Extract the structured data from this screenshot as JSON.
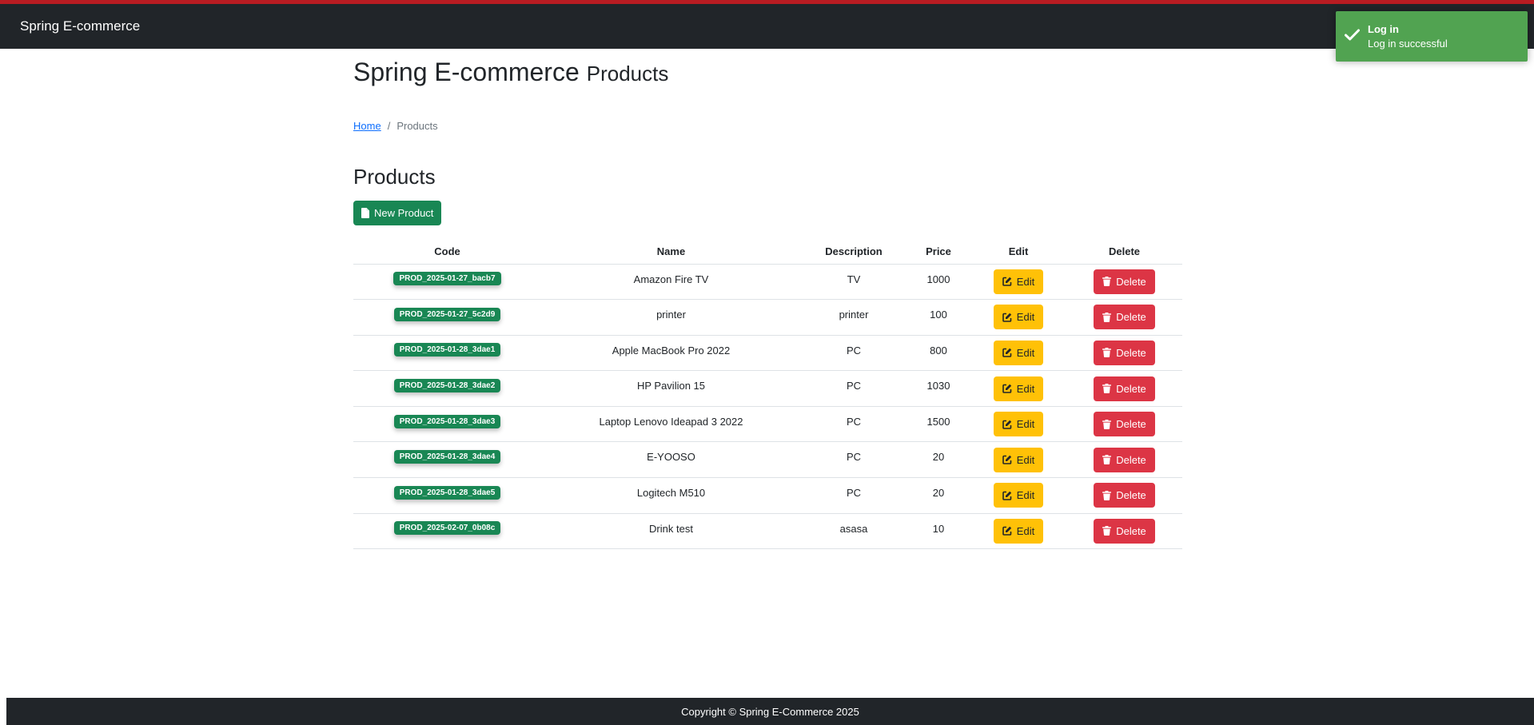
{
  "navbar": {
    "brand": "Spring E-commerce"
  },
  "header": {
    "title": "Spring E-commerce",
    "subtitle": "Products"
  },
  "breadcrumb": {
    "home": "Home",
    "current": "Products"
  },
  "section": {
    "title": "Products",
    "new_button": "New Product"
  },
  "table": {
    "headers": [
      "Code",
      "Name",
      "Description",
      "Price",
      "Edit",
      "Delete"
    ],
    "edit_label": "Edit",
    "delete_label": "Delete",
    "rows": [
      {
        "code": "PROD_2025-01-27_bacb7",
        "name": "Amazon Fire TV",
        "description": "TV",
        "price": "1000"
      },
      {
        "code": "PROD_2025-01-27_5c2d9",
        "name": "printer",
        "description": "printer",
        "price": "100"
      },
      {
        "code": "PROD_2025-01-28_3dae1",
        "name": "Apple MacBook Pro 2022",
        "description": "PC",
        "price": "800"
      },
      {
        "code": "PROD_2025-01-28_3dae2",
        "name": "HP Pavilion 15",
        "description": "PC",
        "price": "1030"
      },
      {
        "code": "PROD_2025-01-28_3dae3",
        "name": "Laptop Lenovo Ideapad 3 2022",
        "description": "PC",
        "price": "1500"
      },
      {
        "code": "PROD_2025-01-28_3dae4",
        "name": "E-YOOSO",
        "description": "PC",
        "price": "20"
      },
      {
        "code": "PROD_2025-01-28_3dae5",
        "name": "Logitech M510",
        "description": "PC",
        "price": "20"
      },
      {
        "code": "PROD_2025-02-07_0b08c",
        "name": "Drink test",
        "description": "asasa",
        "price": "10"
      }
    ]
  },
  "footer": {
    "text": "Copyright © Spring E-Commerce 2025"
  },
  "toast": {
    "title": "Log in",
    "message": "Log in successful"
  },
  "colors": {
    "accent_bar": "#b81c22",
    "navbar": "#212529",
    "success": "#198754",
    "warning": "#ffc107",
    "danger": "#dc3545",
    "toast": "#51a351",
    "link": "#0d6efd"
  },
  "icons": {
    "new_product": "file-icon",
    "edit": "pencil-square-icon",
    "delete": "trash-icon",
    "toast": "check-icon"
  }
}
